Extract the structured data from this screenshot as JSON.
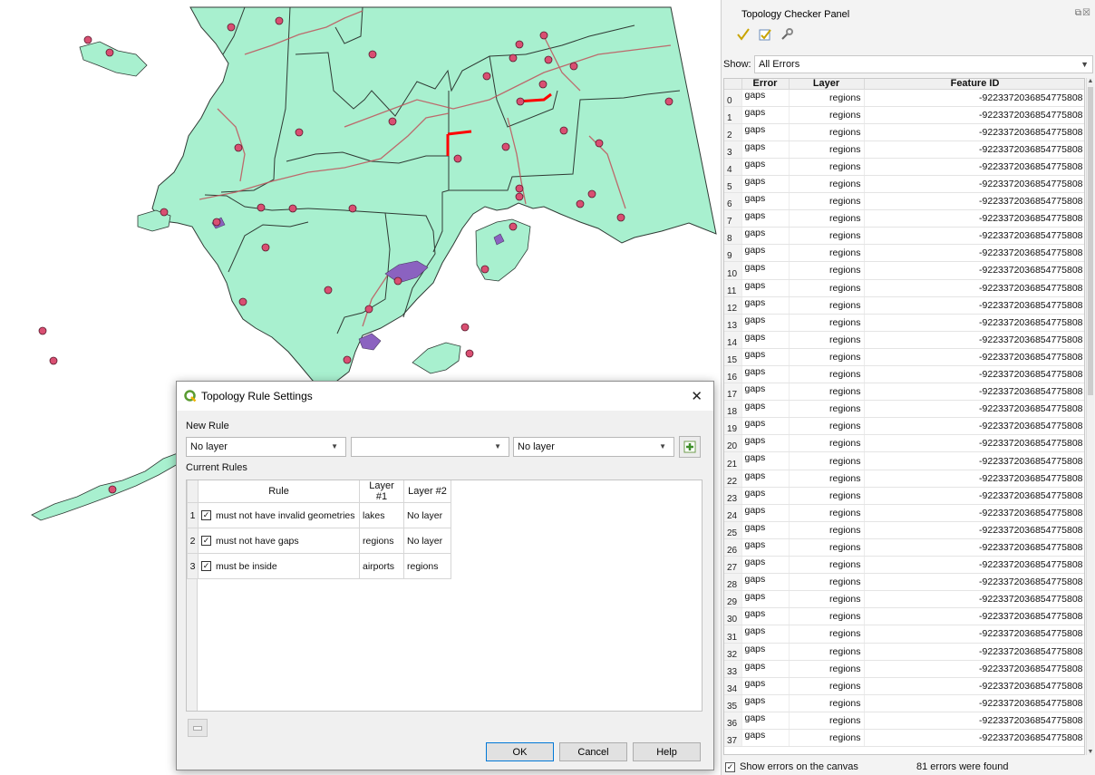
{
  "topology_panel": {
    "title": "Topology Checker Panel",
    "float_icons": "⧉☒",
    "toolbar": [
      "validate-all-icon",
      "validate-extent-icon",
      "configure-rules-icon"
    ],
    "show_label": "Show:",
    "show_value": "All Errors",
    "columns": [
      "Error",
      "Layer",
      "Feature ID"
    ],
    "rows": [
      [
        "0",
        "gaps",
        "regions",
        "-9223372036854775808"
      ],
      [
        "1",
        "gaps",
        "regions",
        "-9223372036854775808"
      ],
      [
        "2",
        "gaps",
        "regions",
        "-9223372036854775808"
      ],
      [
        "3",
        "gaps",
        "regions",
        "-9223372036854775808"
      ],
      [
        "4",
        "gaps",
        "regions",
        "-9223372036854775808"
      ],
      [
        "5",
        "gaps",
        "regions",
        "-9223372036854775808"
      ],
      [
        "6",
        "gaps",
        "regions",
        "-9223372036854775808"
      ],
      [
        "7",
        "gaps",
        "regions",
        "-9223372036854775808"
      ],
      [
        "8",
        "gaps",
        "regions",
        "-9223372036854775808"
      ],
      [
        "9",
        "gaps",
        "regions",
        "-9223372036854775808"
      ],
      [
        "10",
        "gaps",
        "regions",
        "-9223372036854775808"
      ],
      [
        "11",
        "gaps",
        "regions",
        "-9223372036854775808"
      ],
      [
        "12",
        "gaps",
        "regions",
        "-9223372036854775808"
      ],
      [
        "13",
        "gaps",
        "regions",
        "-9223372036854775808"
      ],
      [
        "14",
        "gaps",
        "regions",
        "-9223372036854775808"
      ],
      [
        "15",
        "gaps",
        "regions",
        "-9223372036854775808"
      ],
      [
        "16",
        "gaps",
        "regions",
        "-9223372036854775808"
      ],
      [
        "17",
        "gaps",
        "regions",
        "-9223372036854775808"
      ],
      [
        "18",
        "gaps",
        "regions",
        "-9223372036854775808"
      ],
      [
        "19",
        "gaps",
        "regions",
        "-9223372036854775808"
      ],
      [
        "20",
        "gaps",
        "regions",
        "-9223372036854775808"
      ],
      [
        "21",
        "gaps",
        "regions",
        "-9223372036854775808"
      ],
      [
        "22",
        "gaps",
        "regions",
        "-9223372036854775808"
      ],
      [
        "23",
        "gaps",
        "regions",
        "-9223372036854775808"
      ],
      [
        "24",
        "gaps",
        "regions",
        "-9223372036854775808"
      ],
      [
        "25",
        "gaps",
        "regions",
        "-9223372036854775808"
      ],
      [
        "26",
        "gaps",
        "regions",
        "-9223372036854775808"
      ],
      [
        "27",
        "gaps",
        "regions",
        "-9223372036854775808"
      ],
      [
        "28",
        "gaps",
        "regions",
        "-9223372036854775808"
      ],
      [
        "29",
        "gaps",
        "regions",
        "-9223372036854775808"
      ],
      [
        "30",
        "gaps",
        "regions",
        "-9223372036854775808"
      ],
      [
        "31",
        "gaps",
        "regions",
        "-9223372036854775808"
      ],
      [
        "32",
        "gaps",
        "regions",
        "-9223372036854775808"
      ],
      [
        "33",
        "gaps",
        "regions",
        "-9223372036854775808"
      ],
      [
        "34",
        "gaps",
        "regions",
        "-9223372036854775808"
      ],
      [
        "35",
        "gaps",
        "regions",
        "-9223372036854775808"
      ],
      [
        "36",
        "gaps",
        "regions",
        "-9223372036854775808"
      ],
      [
        "37",
        "gaps",
        "regions",
        "-9223372036854775808"
      ]
    ],
    "show_errors_label": "Show errors on the canvas",
    "show_errors_checked": true,
    "status": "81 errors were found"
  },
  "dialog": {
    "title": "Topology Rule Settings",
    "close_symbol": "✕",
    "new_rule_label": "New Rule",
    "combo1_value": "No layer",
    "combo2_value": "",
    "combo3_value": "No layer",
    "current_rules_label": "Current Rules",
    "rule_columns": [
      "Rule",
      "Layer #1",
      "Layer #2"
    ],
    "rules": [
      {
        "num": "1",
        "rule": "must not have invalid geometries",
        "layer1": "lakes",
        "layer2": "No layer",
        "checked": true
      },
      {
        "num": "2",
        "rule": "must not have gaps",
        "layer1": "regions",
        "layer2": "No layer",
        "checked": true
      },
      {
        "num": "3",
        "rule": "must be inside",
        "layer1": "airports",
        "layer2": "regions",
        "checked": true
      }
    ],
    "buttons": {
      "ok": "OK",
      "cancel": "Cancel",
      "help": "Help"
    }
  },
  "map": {
    "region_fill": "#a8f0cf",
    "border_color": "#2f3a34",
    "river_color": "#c0535b",
    "airport_color": "#d94f72",
    "lake_color": "#8b62c0",
    "error_color": "#ff0000"
  }
}
